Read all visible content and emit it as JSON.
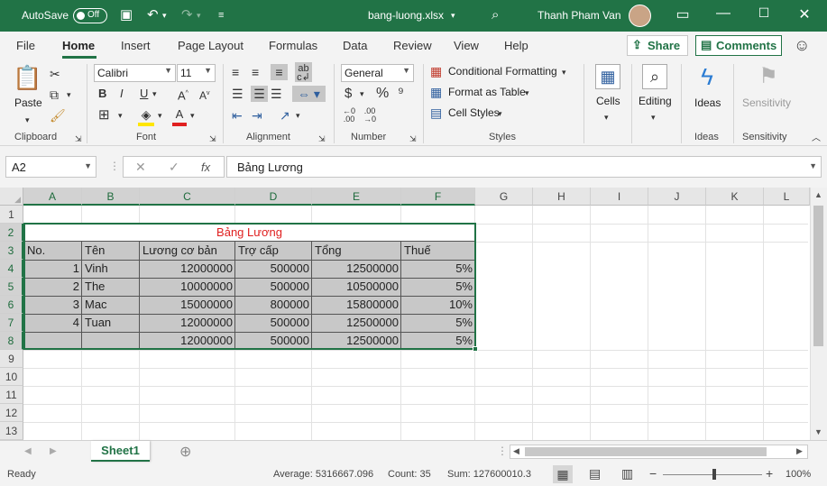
{
  "titlebar": {
    "autosave_label": "AutoSave",
    "autosave_state": "Off",
    "file_name": "bang-luong.xlsx",
    "user_name": "Thanh Pham Van"
  },
  "menu": {
    "tabs": [
      "File",
      "Home",
      "Insert",
      "Page Layout",
      "Formulas",
      "Data",
      "Review",
      "View",
      "Help"
    ],
    "active_tab": "Home",
    "share_label": "Share",
    "comments_label": "Comments"
  },
  "ribbon": {
    "clipboard": {
      "paste_label": "Paste",
      "group_label": "Clipboard"
    },
    "font": {
      "font_name": "Calibri",
      "font_size": "11",
      "group_label": "Font"
    },
    "alignment": {
      "group_label": "Alignment"
    },
    "number": {
      "format": "General",
      "group_label": "Number"
    },
    "styles": {
      "conditional": "Conditional Formatting",
      "format_table": "Format as Table",
      "cell_styles": "Cell Styles",
      "group_label": "Styles"
    },
    "cells": {
      "label": "Cells"
    },
    "editing": {
      "label": "Editing"
    },
    "ideas": {
      "label": "Ideas",
      "group_label": "Ideas"
    },
    "sensitivity": {
      "label": "Sensitivity",
      "group_label": "Sensitivity"
    }
  },
  "formula_bar": {
    "name_box": "A2",
    "fx_label": "fx",
    "content": "Bảng Lương"
  },
  "sheet": {
    "columns": [
      "A",
      "B",
      "C",
      "D",
      "E",
      "F",
      "G",
      "H",
      "I",
      "J",
      "K",
      "L"
    ],
    "rows": [
      "1",
      "2",
      "3",
      "4",
      "5",
      "6",
      "7",
      "8",
      "9",
      "10",
      "11",
      "12",
      "13"
    ],
    "title": "Bảng Lương",
    "headers": [
      "No.",
      "Tên",
      "Lương cơ bản",
      "Trợ cấp",
      "Tổng",
      "Thuế"
    ],
    "data": [
      [
        "1",
        "Vinh",
        "12000000",
        "500000",
        "12500000",
        "5%"
      ],
      [
        "2",
        "The",
        "10000000",
        "500000",
        "10500000",
        "5%"
      ],
      [
        "3",
        "Mac",
        "15000000",
        "800000",
        "15800000",
        "10%"
      ],
      [
        "4",
        "Tuan",
        "12000000",
        "500000",
        "12500000",
        "5%"
      ],
      [
        "",
        "",
        "12000000",
        "500000",
        "12500000",
        "5%"
      ]
    ]
  },
  "sheet_tabs": {
    "active": "Sheet1"
  },
  "status": {
    "ready": "Ready",
    "average": "Average: 5316667.096",
    "count": "Count: 35",
    "sum": "Sum: 127600010.3",
    "zoom": "100%"
  },
  "colors": {
    "accent": "#217346",
    "title_red": "#e02020"
  }
}
